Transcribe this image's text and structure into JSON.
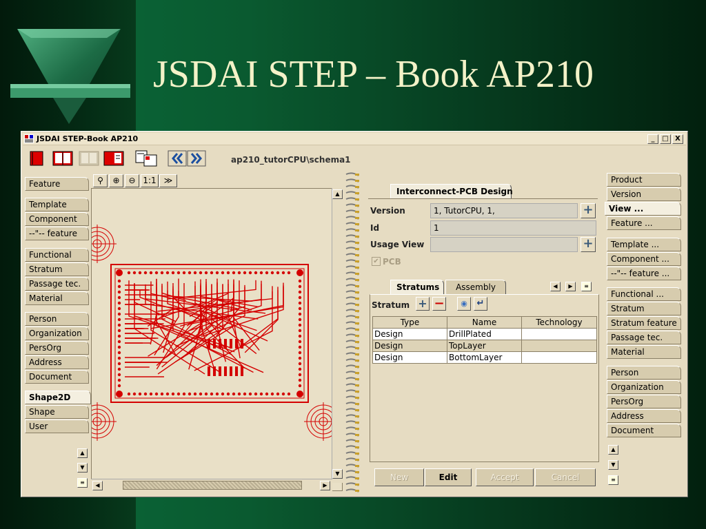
{
  "slide": {
    "title": "JSDAI STEP – Book AP210"
  },
  "window": {
    "title": "JSDAI STEP-Book AP210",
    "controls": [
      "_",
      "□",
      "X"
    ]
  },
  "toolbar": {
    "path": "ap210_tutorCPU\\schema1"
  },
  "left_tabs": [
    {
      "label": "Feature"
    },
    {
      "label": "Template"
    },
    {
      "label": "Component"
    },
    {
      "label": "--\"-- feature"
    },
    {
      "label": "Functional"
    },
    {
      "label": "Stratum"
    },
    {
      "label": "Passage tec."
    },
    {
      "label": "Material"
    },
    {
      "label": "Person"
    },
    {
      "label": "Organization"
    },
    {
      "label": "PersOrg"
    },
    {
      "label": "Address"
    },
    {
      "label": "Document"
    },
    {
      "label": "Shape2D"
    },
    {
      "label": "Shape"
    },
    {
      "label": "User"
    }
  ],
  "zoom_tools": [
    "⚲",
    "⊕",
    "⊖",
    "1:1",
    "≫"
  ],
  "form": {
    "tab": "Interconnect-PCB Design",
    "version_label": "Version",
    "version_value": "1, TutorCPU, 1,",
    "id_label": "Id",
    "id_value": "1",
    "usage_label": "Usage View",
    "usage_value": "",
    "pcb_label": "PCB",
    "pcb_checked": true
  },
  "subtabs": [
    {
      "label": "Stratums"
    },
    {
      "label": "Assembly"
    }
  ],
  "stratum_label": "Stratum",
  "table": {
    "headers": [
      "Type",
      "Name",
      "Technology"
    ],
    "rows": [
      [
        "Design",
        "DrillPlated",
        ""
      ],
      [
        "Design",
        "TopLayer",
        ""
      ],
      [
        "Design",
        "BottomLayer",
        ""
      ]
    ]
  },
  "buttons": {
    "new": "New",
    "edit": "Edit",
    "accept": "Accept",
    "cancel": "Cancel"
  },
  "right_tabs": [
    {
      "label": "Product"
    },
    {
      "label": "Version"
    },
    {
      "label": "View ..."
    },
    {
      "label": "Feature ..."
    },
    {
      "label": "Template ..."
    },
    {
      "label": "Component ..."
    },
    {
      "label": "--\"-- feature ..."
    },
    {
      "label": "Functional ..."
    },
    {
      "label": "Stratum"
    },
    {
      "label": "Stratum feature"
    },
    {
      "label": "Passage tec."
    },
    {
      "label": "Material"
    },
    {
      "label": "Person"
    },
    {
      "label": "Organization"
    },
    {
      "label": "PersOrg"
    },
    {
      "label": "Address"
    },
    {
      "label": "Document"
    }
  ]
}
